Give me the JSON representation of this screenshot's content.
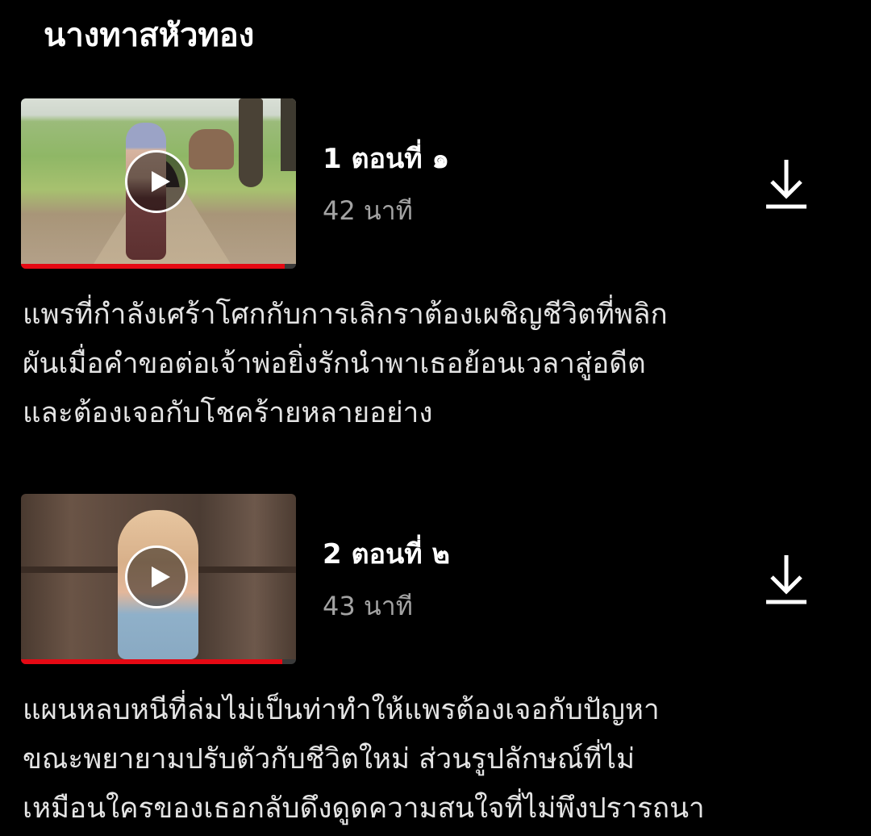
{
  "season": {
    "title": "นางทาสหัวทอง"
  },
  "colors": {
    "background": "#000000",
    "progress": "#e50914",
    "secondary_text": "#a3a3a3"
  },
  "episodes": [
    {
      "title": "1 ตอนที่ ๑",
      "duration": "42 นาที",
      "progress_fraction": 0.96,
      "play_icon": "play-icon",
      "download_icon": "download-icon",
      "description_lines": [
        "แพรที่กำลังเศร้าโศกกับการเลิกราต้องเผชิญชีวิตที่พลิก",
        "ผันเมื่อคำขอต่อเจ้าพ่อยิ่งรักนำพาเธอย้อนเวลาสู่อดีต",
        "และต้องเจอกับโชคร้ายหลายอย่าง"
      ]
    },
    {
      "title": "2 ตอนที่ ๒",
      "duration": "43 นาที",
      "progress_fraction": 0.95,
      "play_icon": "play-icon",
      "download_icon": "download-icon",
      "description_lines": [
        "แผนหลบหนีที่ล่มไม่เป็นท่าทำให้แพรต้องเจอกับปัญหา",
        "ขณะพยายามปรับตัวกับชีวิตใหม่ ส่วนรูปลักษณ์ที่ไม่",
        "เหมือนใครของเธอกลับดึงดูดความสนใจที่ไม่พึงปรารถนา"
      ]
    }
  ]
}
